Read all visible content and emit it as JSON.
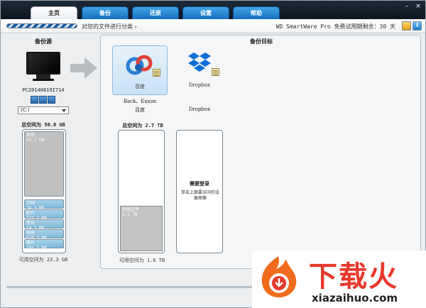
{
  "tabs": [
    {
      "label": "主页",
      "active": true
    },
    {
      "label": "备份",
      "active": false
    },
    {
      "label": "还原",
      "active": false
    },
    {
      "label": "设置",
      "active": false
    },
    {
      "label": "帮助",
      "active": false
    }
  ],
  "window_controls": {
    "minimize": "–",
    "close": "×"
  },
  "progress": {
    "text": "对您的文件进行分类 ›",
    "trial_text": "WD SmartWare Pro 免费试用期剩余：30 天",
    "info_label": "i"
  },
  "source": {
    "title": "备份源",
    "computer_name": "PC20140819I714",
    "drive": "(C:)",
    "total_space": "总空间为 50.0 GB",
    "segments": [
      {
        "name": "系统",
        "size": "23.7 GB"
      },
      {
        "name": "文档",
        "size": "24.3 MB"
      },
      {
        "name": "影片",
        "size": "722.1 MB"
      },
      {
        "name": "音乐",
        "size": "14.2 MB"
      },
      {
        "name": "其他",
        "size": "620.3 MB"
      },
      {
        "name": "图片",
        "size": "105.5 MB"
      }
    ],
    "available": "可用空间为 23.3 GB"
  },
  "target": {
    "title": "备份目标",
    "baidu": {
      "tile_label": "百度",
      "caption": "Back、Exxon",
      "name": "百度"
    },
    "dropbox": {
      "tile_label": "Dropbox",
      "name": "Dropbox"
    },
    "total_space": "总空间为 2.7 TB",
    "used": {
      "name": "其他文件",
      "size": "1.1 TB"
    },
    "available": "可用空间为 1.6 TB",
    "login_title": "需要登录",
    "login_desc": "单击上面要访问的设备图像"
  },
  "watermark": {
    "title": "下载火",
    "url": "xiazaihuo.com"
  },
  "colors": {
    "tab_blue": "#1470c0",
    "dropbox_blue": "#0d6fd9",
    "brand_red": "#e8382a"
  }
}
